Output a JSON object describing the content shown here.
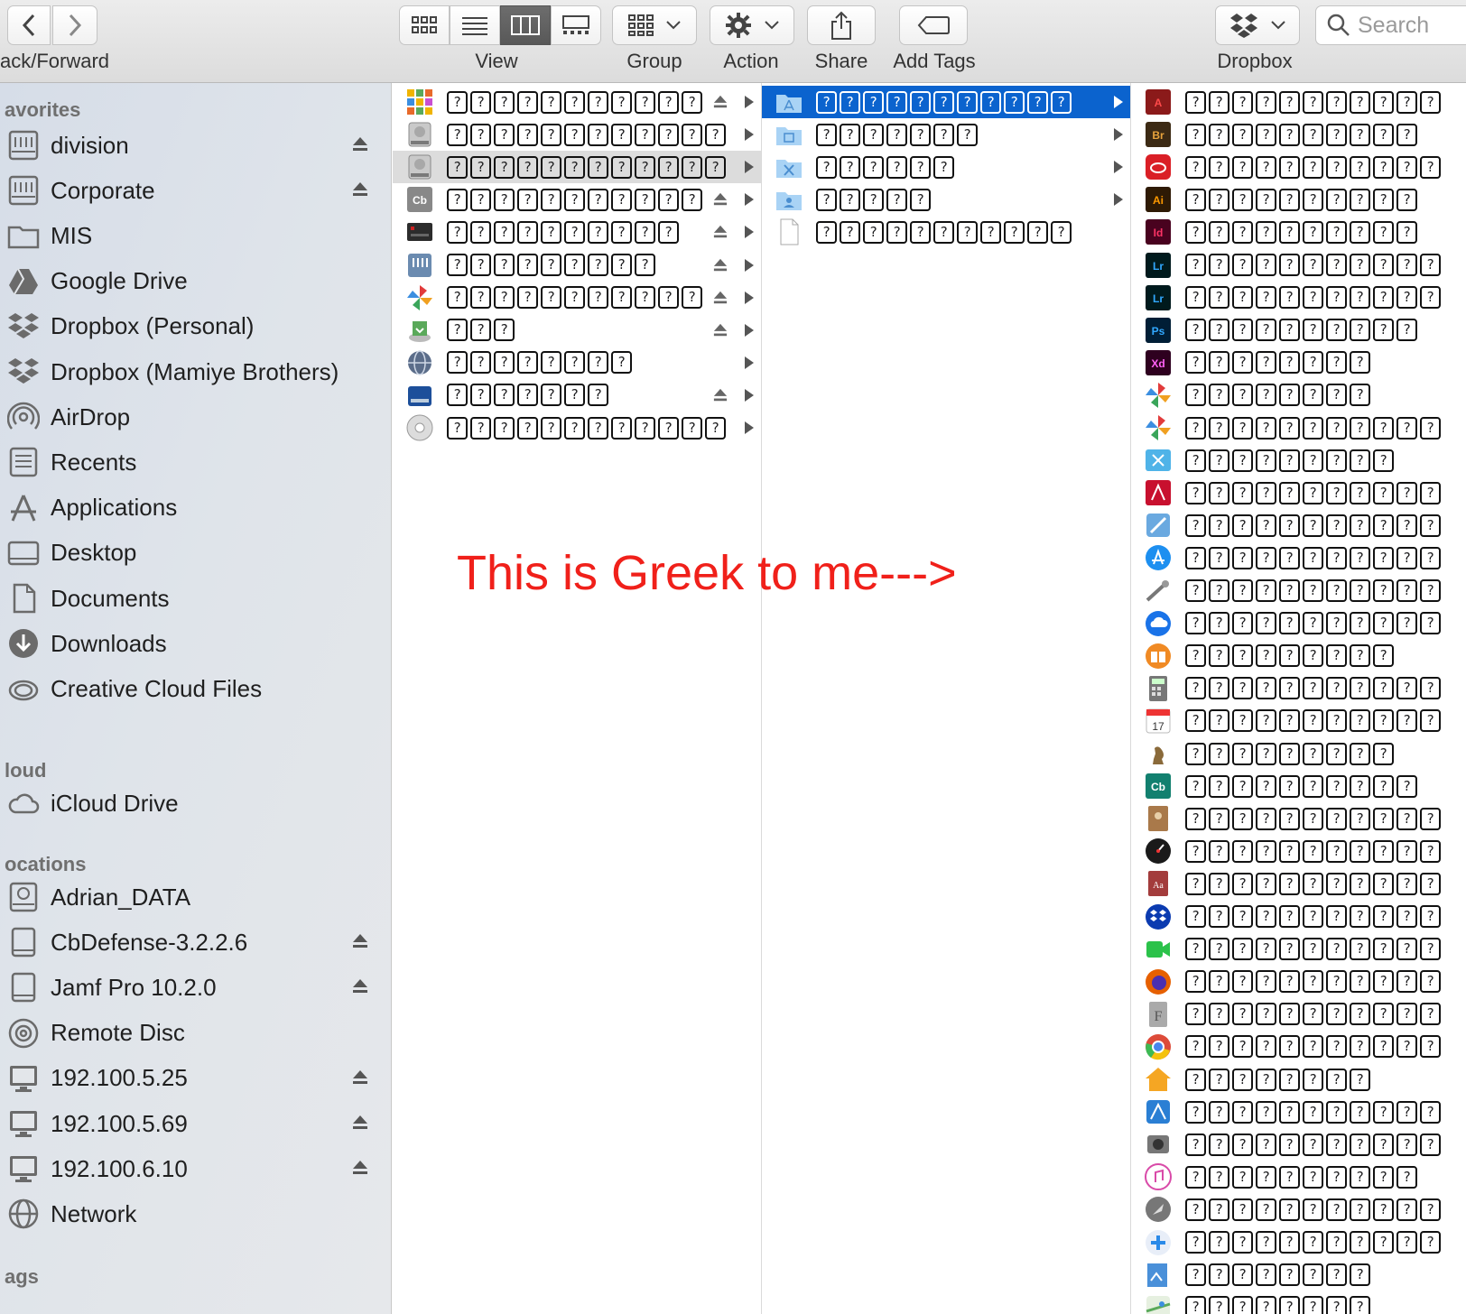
{
  "toolbar": {
    "back_forward_label": "ack/Forward",
    "view_label": "View",
    "group_label": "Group",
    "action_label": "Action",
    "share_label": "Share",
    "add_tags_label": "Add Tags",
    "dropbox_label": "Dropbox",
    "search_placeholder": "Search"
  },
  "sidebar": {
    "favorites_header": "avorites",
    "favorites": [
      {
        "label": "division",
        "icon": "server-icon",
        "eject": true
      },
      {
        "label": "Corporate",
        "icon": "server-icon",
        "eject": true
      },
      {
        "label": "MIS",
        "icon": "folder-icon",
        "eject": false
      },
      {
        "label": "Google Drive",
        "icon": "google-drive-icon",
        "eject": false
      },
      {
        "label": "Dropbox (Personal)",
        "icon": "dropbox-icon",
        "eject": false
      },
      {
        "label": "Dropbox (Mamiye Brothers)",
        "icon": "dropbox-icon",
        "eject": false
      },
      {
        "label": "AirDrop",
        "icon": "airdrop-icon",
        "eject": false
      },
      {
        "label": "Recents",
        "icon": "recents-icon",
        "eject": false
      },
      {
        "label": "Applications",
        "icon": "applications-icon",
        "eject": false
      },
      {
        "label": "Desktop",
        "icon": "desktop-icon",
        "eject": false
      },
      {
        "label": "Documents",
        "icon": "documents-icon",
        "eject": false
      },
      {
        "label": "Downloads",
        "icon": "downloads-icon",
        "eject": false
      },
      {
        "label": "Creative Cloud Files",
        "icon": "creative-cloud-icon",
        "eject": false
      }
    ],
    "icloud_header": "loud",
    "icloud": [
      {
        "label": "iCloud Drive",
        "icon": "cloud-icon",
        "eject": false
      }
    ],
    "locations_header": "ocations",
    "locations": [
      {
        "label": "Adrian_DATA",
        "icon": "hard-drive-icon",
        "eject": false
      },
      {
        "label": "CbDefense-3.2.2.6",
        "icon": "disk-image-icon",
        "eject": true
      },
      {
        "label": "Jamf Pro 10.2.0",
        "icon": "disk-image-icon",
        "eject": true
      },
      {
        "label": "Remote Disc",
        "icon": "remote-disc-icon",
        "eject": false
      },
      {
        "label": "192.100.5.25",
        "icon": "monitor-icon",
        "eject": true
      },
      {
        "label": "192.100.5.69",
        "icon": "monitor-icon",
        "eject": true
      },
      {
        "label": "192.100.6.10",
        "icon": "monitor-icon",
        "eject": true
      },
      {
        "label": "Network",
        "icon": "network-icon",
        "eject": false
      }
    ],
    "tags_header": "ags"
  },
  "column1": [
    {
      "chars": 11,
      "icon": "app-grid-icon",
      "eject": true,
      "chevron": true
    },
    {
      "chars": 12,
      "icon": "hard-drive-icon",
      "eject": false,
      "chevron": true
    },
    {
      "chars": 12,
      "icon": "hard-drive-icon",
      "eject": false,
      "chevron": true,
      "selected": true
    },
    {
      "chars": 11,
      "icon": "cbdefense-icon",
      "eject": true,
      "chevron": true
    },
    {
      "chars": 10,
      "icon": "jamf-icon",
      "eject": true,
      "chevron": true
    },
    {
      "chars": 9,
      "icon": "server-icon",
      "eject": true,
      "chevron": true
    },
    {
      "chars": 11,
      "icon": "pinwheel-icon",
      "eject": true,
      "chevron": true
    },
    {
      "chars": 3,
      "icon": "installer-icon",
      "eject": true,
      "chevron": true
    },
    {
      "chars": 8,
      "icon": "network-globe-icon",
      "eject": false,
      "chevron": true
    },
    {
      "chars": 7,
      "icon": "drive-blue-icon",
      "eject": true,
      "chevron": true
    },
    {
      "chars": 12,
      "icon": "remote-disc-icon",
      "eject": false,
      "chevron": true
    }
  ],
  "column2": [
    {
      "chars": 11,
      "icon": "applications-folder-icon",
      "chevron": true,
      "selected": true
    },
    {
      "chars": 7,
      "icon": "library-folder-icon",
      "chevron": true
    },
    {
      "chars": 6,
      "icon": "system-folder-icon",
      "chevron": true
    },
    {
      "chars": 5,
      "icon": "users-folder-icon",
      "chevron": true
    },
    {
      "chars": 11,
      "icon": "document-icon",
      "chevron": false
    }
  ],
  "column3": [
    {
      "chars": 11,
      "icon": "acrobat-icon",
      "color": "#8b1a1a"
    },
    {
      "chars": 10,
      "icon": "bridge-icon",
      "color": "#3c2a14"
    },
    {
      "chars": 11,
      "icon": "creative-cloud-icon",
      "color": "#da1f26"
    },
    {
      "chars": 10,
      "icon": "illustrator-icon",
      "color": "#2e1a05"
    },
    {
      "chars": 10,
      "icon": "indesign-icon",
      "color": "#49021f"
    },
    {
      "chars": 11,
      "icon": "lightroom-icon",
      "color": "#001a1d"
    },
    {
      "chars": 11,
      "icon": "lightroom-classic-icon",
      "color": "#001a1d"
    },
    {
      "chars": 10,
      "icon": "photoshop-icon",
      "color": "#001e36"
    },
    {
      "chars": 8,
      "icon": "xd-icon",
      "color": "#2e001f"
    },
    {
      "chars": 8,
      "icon": "pinwheel-icon",
      "color": "#ffffff"
    },
    {
      "chars": 11,
      "icon": "pinwheel-icon",
      "color": "#ffffff"
    },
    {
      "chars": 9,
      "icon": "xcode-tool-icon",
      "color": "#4fb3e8"
    },
    {
      "chars": 11,
      "icon": "acrobat-reader-icon",
      "color": "#c8102e"
    },
    {
      "chars": 11,
      "icon": "utility-icon",
      "color": "#5aa0d8"
    },
    {
      "chars": 11,
      "icon": "app-store-icon",
      "color": "#1d8ff0"
    },
    {
      "chars": 11,
      "icon": "automator-icon",
      "color": "#888888"
    },
    {
      "chars": 11,
      "icon": "backup-icon",
      "color": "#1a73e8"
    },
    {
      "chars": 9,
      "icon": "books-icon",
      "color": "#f08a24"
    },
    {
      "chars": 11,
      "icon": "calculator-icon",
      "color": "#777777"
    },
    {
      "chars": 11,
      "icon": "calendar-icon",
      "color": "#ffffff"
    },
    {
      "chars": 9,
      "icon": "chess-icon",
      "color": "#8a6a3a"
    },
    {
      "chars": 10,
      "icon": "cbdefense-icon",
      "color": "#12806f"
    },
    {
      "chars": 11,
      "icon": "contacts-icon",
      "color": "#a9794a"
    },
    {
      "chars": 11,
      "icon": "dashboard-icon",
      "color": "#1a1a1a"
    },
    {
      "chars": 11,
      "icon": "dictionary-icon",
      "color": "#a33c3c"
    },
    {
      "chars": 11,
      "icon": "dropbox-icon",
      "color": "#0b3bb0"
    },
    {
      "chars": 11,
      "icon": "facetime-icon",
      "color": "#2bc24a"
    },
    {
      "chars": 11,
      "icon": "firefox-icon",
      "color": "#e66000"
    },
    {
      "chars": 11,
      "icon": "font-book-icon",
      "color": "#8a8a8a"
    },
    {
      "chars": 11,
      "icon": "chrome-icon",
      "color": "#dd4b39"
    },
    {
      "chars": 8,
      "icon": "home-icon",
      "color": "#f5a623"
    },
    {
      "chars": 11,
      "icon": "image-capture-icon",
      "color": "#2a7fd4"
    },
    {
      "chars": 11,
      "icon": "image-capture-camera-icon",
      "color": "#555555"
    },
    {
      "chars": 10,
      "icon": "itunes-icon",
      "color": "#d94aa8"
    },
    {
      "chars": 11,
      "icon": "launchpad-icon",
      "color": "#777777"
    },
    {
      "chars": 11,
      "icon": "self-service-icon",
      "color": "#2a8ae8"
    },
    {
      "chars": 8,
      "icon": "preview-icon",
      "color": "#4a90d9"
    },
    {
      "chars": 8,
      "icon": "maps-icon",
      "color": "#5aa95a"
    }
  ],
  "annotation": "This is Greek to me--->",
  "placeholder_glyph": "?"
}
